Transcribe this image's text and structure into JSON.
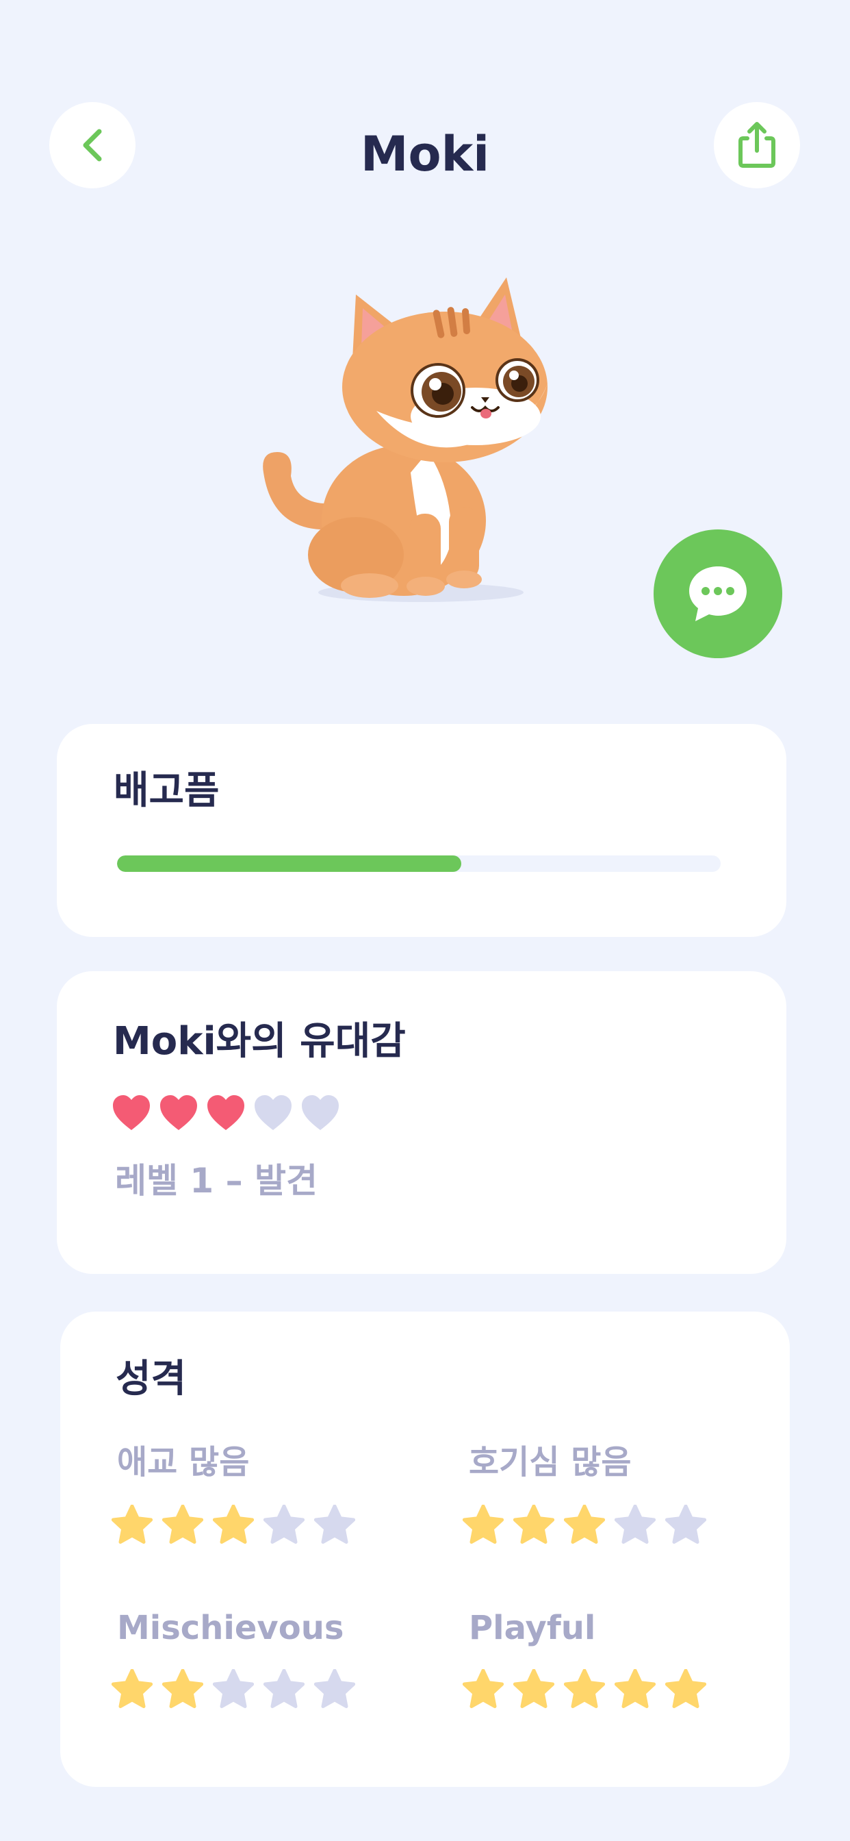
{
  "header": {
    "title": "Moki"
  },
  "hunger": {
    "title": "배고픔",
    "level": 0.57
  },
  "bond": {
    "title": "Moki와의 유대감",
    "hearts_filled": 3,
    "hearts_total": 5,
    "level_text": "레벨 1 – 발견"
  },
  "personality": {
    "title": "성격",
    "traits": [
      {
        "label": "애교 많음",
        "stars": 3,
        "max": 5
      },
      {
        "label": "호기심 많음",
        "stars": 3,
        "max": 5
      },
      {
        "label": "Mischievous",
        "stars": 2,
        "max": 5
      },
      {
        "label": "Playful",
        "stars": 5,
        "max": 5
      }
    ]
  },
  "colors": {
    "background": "#eff3fd",
    "accent_green": "#6cc75a",
    "heart_filled": "#f45b74",
    "heart_empty": "#d6d9ee",
    "star_filled": "#ffd66b",
    "star_empty": "#d6d9ee",
    "title_text": "#262a4f",
    "muted_text": "#a7a9c8"
  },
  "icons": {
    "back": "chevron-left-icon",
    "share": "share-icon",
    "chat": "chat-bubble-icon",
    "heart": "heart-icon",
    "star": "star-icon"
  }
}
